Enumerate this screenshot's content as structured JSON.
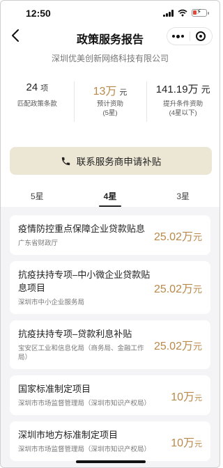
{
  "status_bar": {
    "time": "12:50"
  },
  "nav": {
    "title": "政策服务报告"
  },
  "company": "深圳优美创新网络科技有限公司",
  "stats": [
    {
      "value": "24",
      "unit": "项",
      "label": "匹配政策条款",
      "sublabel": ""
    },
    {
      "value": "13万",
      "unit": "元",
      "label": "预计资助",
      "sublabel": "(5星)"
    },
    {
      "value": "141.19万",
      "unit": "元",
      "label": "提升条件资助",
      "sublabel": "(4星以下)"
    }
  ],
  "cta": {
    "label": "联系服务商申请补贴"
  },
  "tabs": [
    {
      "label": "5星",
      "active": false
    },
    {
      "label": "4星",
      "active": true
    },
    {
      "label": "3星",
      "active": false
    }
  ],
  "policies": [
    {
      "title": "疫情防控重点保障企业贷款贴息",
      "org": "广东省财政厅",
      "amount": "25.02万",
      "unit": "元"
    },
    {
      "title": "抗疫扶持专项–中小微企业贷款贴息项目",
      "org": "深圳市中小企业服务局",
      "amount": "25.02万",
      "unit": "元"
    },
    {
      "title": "抗疫扶持专项–贷款利息补贴",
      "org": "宝安区工业和信息化局（商务局、金融工作局）",
      "amount": "25.02万",
      "unit": "元"
    },
    {
      "title": "国家标准制定项目",
      "org": "深圳市市场监督管理局（深圳市知识产权局）",
      "amount": "10万",
      "unit": "元"
    },
    {
      "title": "深圳市地方标准制定项目",
      "org": "深圳市市场监督管理局（深圳市知识产权局）",
      "amount": "10万",
      "unit": "元"
    }
  ],
  "colors": {
    "accent": "#b8894a",
    "cta_bg": "#ece6d4",
    "list_bg": "#f4f4f6"
  },
  "icons": [
    "signal-icon",
    "wifi-icon",
    "battery-charging-icon",
    "back-arrow-icon",
    "more-dots-icon",
    "close-target-icon",
    "phone-icon"
  ]
}
